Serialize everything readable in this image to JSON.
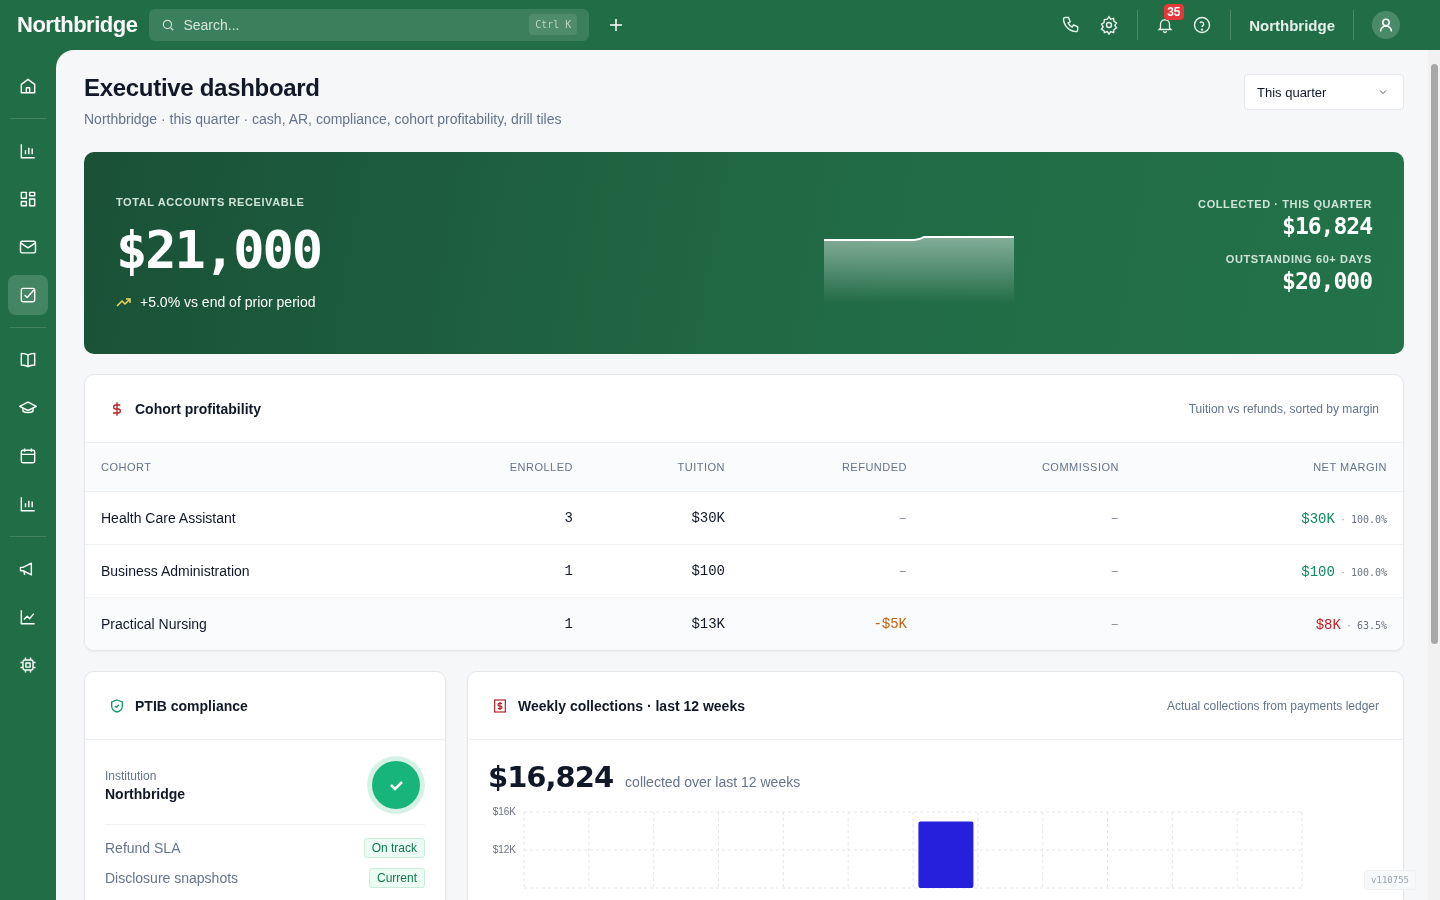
{
  "topbar": {
    "brand": "Northbridge",
    "search": {
      "placeholder": "Search...",
      "shortcut": "Ctrl K"
    },
    "notifications": "35",
    "account": "Northbridge"
  },
  "sidebar": {
    "items": [
      {
        "selected": false
      },
      {
        "selected": false
      },
      {
        "selected": false
      },
      {
        "selected": false
      },
      {
        "selected": true
      },
      {
        "selected": false
      },
      {
        "selected": false
      },
      {
        "selected": false
      },
      {
        "selected": false
      },
      {
        "selected": false
      },
      {
        "selected": false
      },
      {
        "selected": false
      }
    ]
  },
  "page": {
    "title": "Executive dashboard",
    "subtitle": "Northbridge · this quarter · cash, AR, compliance, cohort profitability, drill tiles",
    "period": "This quarter"
  },
  "hero": {
    "label": "TOTAL ACCOUNTS RECEIVABLE",
    "value": "$21,000",
    "trend": "+5.0% vs end of prior period",
    "stats": [
      {
        "label": "COLLECTED · THIS QUARTER",
        "value": "$16,824"
      },
      {
        "label": "OUTSTANDING 60+ DAYS",
        "value": "$20,000"
      }
    ]
  },
  "cohorts": {
    "title": "Cohort profitability",
    "note": "Tuition vs refunds, sorted by margin",
    "columns": [
      "COHORT",
      "ENROLLED",
      "TUITION",
      "REFUNDED",
      "COMMISSION",
      "NET MARGIN"
    ],
    "rows": [
      {
        "cohort": "Health Care Assistant",
        "enrolled": "3",
        "tuition": "$30K",
        "refunded": "–",
        "refund_flagged": false,
        "commission": "–",
        "margin": "$30K",
        "separator": "·",
        "percent": "100.0%",
        "margin_low": false
      },
      {
        "cohort": "Business Administration",
        "enrolled": "1",
        "tuition": "$100",
        "refunded": "–",
        "refund_flagged": false,
        "commission": "–",
        "margin": "$100",
        "separator": "·",
        "percent": "100.0%",
        "margin_low": false
      },
      {
        "cohort": "Practical Nursing",
        "enrolled": "1",
        "tuition": "$13K",
        "refunded": "-$5K",
        "refund_flagged": true,
        "commission": "–",
        "margin": "$8K",
        "separator": "·",
        "percent": "63.5%",
        "margin_low": true
      }
    ]
  },
  "compliance": {
    "title": "PTIB compliance",
    "institution_label": "Institution",
    "institution": "Northbridge",
    "status_ok": true,
    "items": [
      {
        "label": "Refund SLA",
        "badge": "On track"
      },
      {
        "label": "Disclosure snapshots",
        "badge": "Current"
      }
    ]
  },
  "collections": {
    "title": "Weekly collections · last 12 weeks",
    "note": "Actual collections from payments ledger",
    "total": "$16,824",
    "caption": "collected over last 12 weeks",
    "chart_data": {
      "type": "bar",
      "series": [
        {
          "color": "#2620dc",
          "values": [
            null,
            null,
            null,
            null,
            null,
            null,
            15000,
            null,
            null,
            null,
            null,
            null
          ]
        }
      ],
      "ylim": [
        8000,
        16000
      ],
      "yticks": [
        {
          "value": 12000,
          "label": "$12K"
        },
        {
          "value": 16000,
          "label": "$16K"
        }
      ]
    }
  },
  "version": "v110755"
}
